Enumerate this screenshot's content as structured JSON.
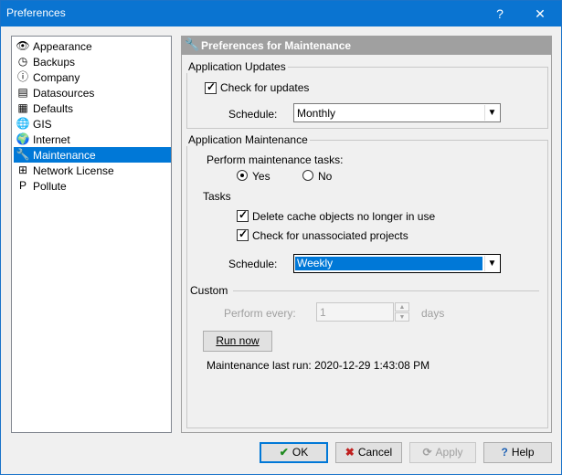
{
  "window": {
    "title": "Preferences",
    "help_glyph": "?",
    "close_glyph": "✕"
  },
  "tree": {
    "items": [
      {
        "label": "Appearance",
        "icon": "eye-icon",
        "glyph": "👁"
      },
      {
        "label": "Backups",
        "icon": "clock-icon",
        "glyph": "◷"
      },
      {
        "label": "Company",
        "icon": "info-icon",
        "glyph": "ⓘ"
      },
      {
        "label": "Datasources",
        "icon": "datasource-icon",
        "glyph": "▤"
      },
      {
        "label": "Defaults",
        "icon": "defaults-icon",
        "glyph": "▦"
      },
      {
        "label": "GIS",
        "icon": "globe-icon",
        "glyph": "🌐"
      },
      {
        "label": "Internet",
        "icon": "internet-globe-icon",
        "glyph": "🌍"
      },
      {
        "label": "Maintenance",
        "icon": "wrench-icon",
        "glyph": "🔧"
      },
      {
        "label": "Network License",
        "icon": "network-icon",
        "glyph": "⊞"
      },
      {
        "label": "Pollute",
        "icon": "pollute-icon",
        "glyph": "P"
      }
    ],
    "selected_index": 7
  },
  "panel": {
    "header": "Preferences for Maintenance",
    "header_glyph": "🔧",
    "updates": {
      "group_label": "Application Updates",
      "check_label": "Check for updates",
      "checked": true,
      "schedule_label": "Schedule:",
      "schedule_value": "Monthly"
    },
    "maintenance": {
      "group_label": "Application Maintenance",
      "perform_label": "Perform maintenance tasks:",
      "yes_label": "Yes",
      "no_label": "No",
      "selected": "Yes",
      "tasks_label": "Tasks",
      "task_delete": "Delete cache objects no longer in use",
      "task_check": "Check for unassociated projects",
      "schedule_label": "Schedule:",
      "schedule_value": "Weekly",
      "custom_label": "Custom",
      "perform_every_label": "Perform every:",
      "perform_every_value": "1",
      "days_label": "days",
      "run_now_label": "Run now",
      "last_run": "Maintenance last run: 2020-12-29 1:43:08 PM"
    }
  },
  "buttons": {
    "ok": "OK",
    "cancel": "Cancel",
    "apply": "Apply",
    "help": "Help"
  },
  "colors": {
    "titlebar": "#0a74d1",
    "selection": "#0078d7",
    "header": "#a0a0a0"
  }
}
